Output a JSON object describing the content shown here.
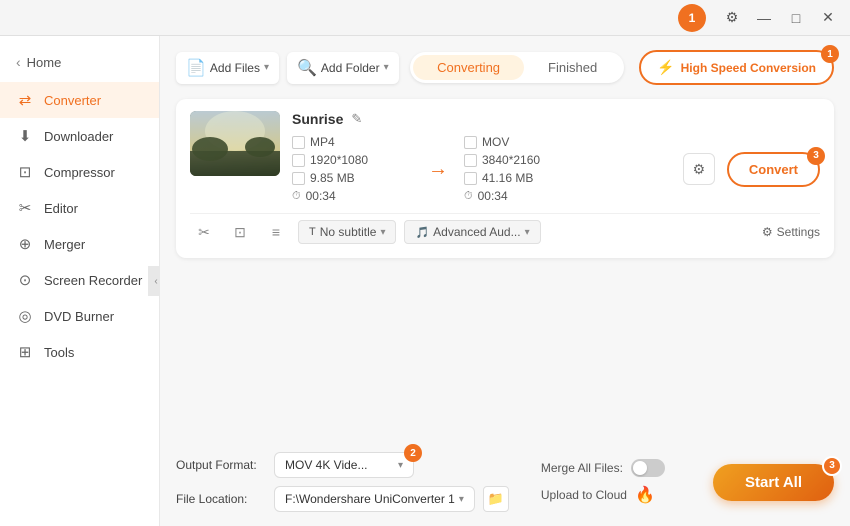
{
  "titleBar": {
    "userBadge": "1",
    "minimize": "—",
    "maximize": "□",
    "close": "✕"
  },
  "sidebar": {
    "home": "Home",
    "items": [
      {
        "id": "converter",
        "label": "Converter",
        "icon": "⇄",
        "active": true
      },
      {
        "id": "downloader",
        "label": "Downloader",
        "icon": "↓"
      },
      {
        "id": "compressor",
        "label": "Compressor",
        "icon": "⊞"
      },
      {
        "id": "editor",
        "label": "Editor",
        "icon": "✂"
      },
      {
        "id": "merger",
        "label": "Merger",
        "icon": "⊕"
      },
      {
        "id": "screen-recorder",
        "label": "Screen Recorder",
        "icon": "⊙"
      },
      {
        "id": "dvd-burner",
        "label": "DVD Burner",
        "icon": "◎"
      },
      {
        "id": "tools",
        "label": "Tools",
        "icon": "⊞"
      }
    ],
    "collapseLabel": "‹"
  },
  "toolbar": {
    "addFileLabel": "Add Files",
    "addFileDropdown": "▾",
    "addFolderLabel": "Add Folder",
    "addFolderDropdown": "▾",
    "tabs": [
      {
        "id": "converting",
        "label": "Converting",
        "active": true
      },
      {
        "id": "finished",
        "label": "Finished"
      }
    ],
    "highSpeedLabel": "High Speed Conversion",
    "lightningIcon": "⚡",
    "badgeNum1": "1"
  },
  "fileCard": {
    "fileName": "Sunrise",
    "editIcon": "✎",
    "source": {
      "format": "MP4",
      "resolution": "1920*1080",
      "size": "9.85 MB",
      "duration": "00:34"
    },
    "arrow": "→",
    "dest": {
      "format": "MOV",
      "resolution": "3840*2160",
      "size": "41.16 MB",
      "duration": "00:34"
    },
    "settingsIcon": "⚙",
    "convertLabel": "Convert",
    "badgeNum": "3",
    "bottomActions": {
      "cut": "✂",
      "crop": "⊡",
      "list": "≡",
      "subtitleLabel": "No subtitle",
      "audioLabel": "Advanced Aud...",
      "settingsLabel": "Settings",
      "settingsIcon": "⚙"
    }
  },
  "bottomBar": {
    "outputFormatLabel": "Output Format:",
    "outputFormatValue": "MOV 4K Vide...",
    "badgeNum2": "2",
    "fileLocationLabel": "File Location:",
    "fileLocationValue": "F:\\Wondershare UniConverter 1",
    "mergeLabel": "Merge All Files:",
    "uploadLabel": "Upload to Cloud",
    "cloudIcon": "🔥",
    "startAllLabel": "Start All",
    "badgeNum3": "3"
  }
}
